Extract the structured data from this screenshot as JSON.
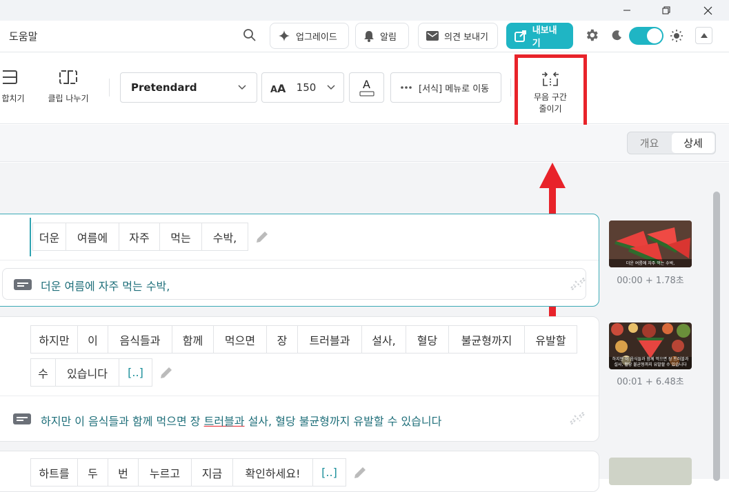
{
  "header": {
    "help": "도움말",
    "upgrade": "업그레이드",
    "alerts": "알림",
    "feedback": "의견 보내기",
    "export": "내보내기"
  },
  "toolbar": {
    "merge_clip": "합치기",
    "split_clip": "클립 나누기",
    "font_family": "Pretendard",
    "font_size": "150",
    "format_menu": "[서식] 메뉴로 이동",
    "silence_line1": "무음 구간",
    "silence_line2": "줄이기"
  },
  "view_toggle": {
    "overview": "개요",
    "detail": "상세"
  },
  "clips": [
    {
      "words": [
        "더운",
        "여름에",
        "자주",
        "먹는",
        "수박,"
      ],
      "subtitle": "더운 여름에 자주 먹는 수박,",
      "thumb_caption": "더운 여름에 자주 먹는 수박,",
      "time": "00:00 + 1.78초"
    },
    {
      "words_row1": [
        "하지만",
        "이",
        "음식들과",
        "함께",
        "먹으면",
        "장",
        "트러블과",
        "설사,",
        "혈당",
        "불균형까지",
        "유발할"
      ],
      "words_row2": [
        "수",
        "있습니다",
        "[..]"
      ],
      "subtitle_before": "하지만 이 음식들과 함께 먹으면 장 ",
      "subtitle_underlined": "트러블과",
      "subtitle_after": " 설사, 혈당 불균형까지 유발할 수 있습니다",
      "thumb_caption": "하지만 이 음식들과 함께 먹으면 장 트러블과 설사, 혈당 불균형까지 유발할 수 있습니다",
      "time": "00:01 + 6.48초"
    },
    {
      "words": [
        "하트를",
        "두",
        "번",
        "누르고",
        "지금",
        "확인하세요!",
        "[..]"
      ]
    }
  ],
  "colors": {
    "accent": "#1fb5c4",
    "highlight_box": "#e8232a",
    "subtitle_text": "#1f6f7a"
  }
}
